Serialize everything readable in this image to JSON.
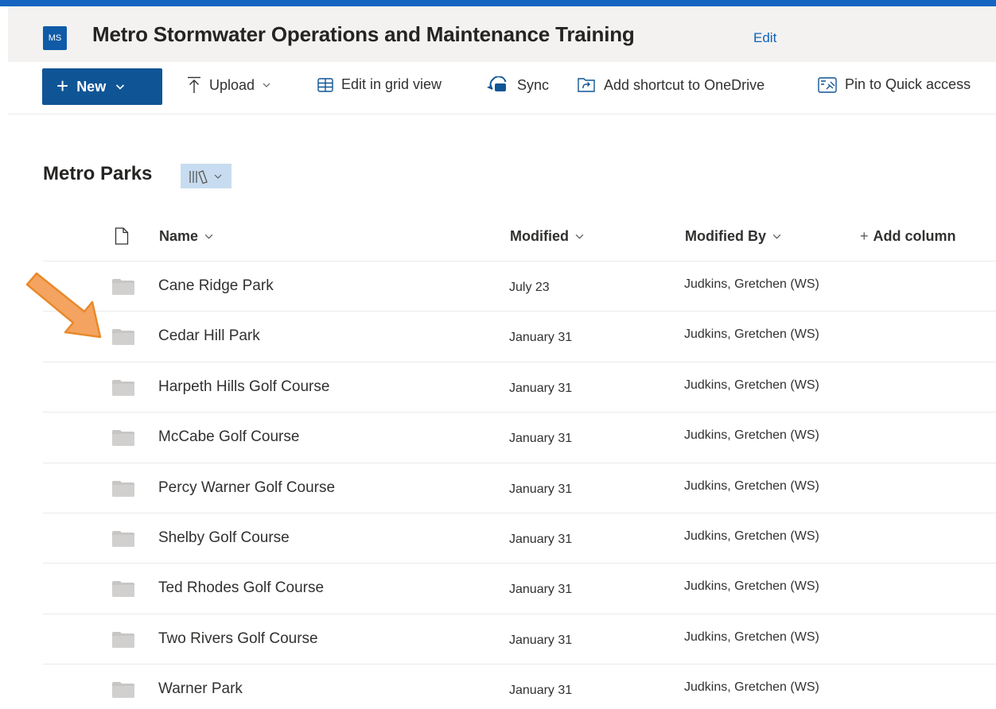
{
  "site": {
    "logo_initials": "MS",
    "title": "Metro Stormwater Operations and Maintenance Training",
    "edit_label": "Edit"
  },
  "colors": {
    "accent_bar": "#1565c0",
    "primary_button": "#0f5596",
    "view_button_bg": "#c7dcf0",
    "arrow_fill": "#f4a460",
    "arrow_stroke": "#e8892a"
  },
  "commands": {
    "new_label": "New",
    "upload_label": "Upload",
    "grid_view_label": "Edit in grid view",
    "sync_label": "Sync",
    "shortcut_label": "Add shortcut to OneDrive",
    "pin_label": "Pin to Quick access"
  },
  "library": {
    "title": "Metro Parks",
    "view_icon": "library-view-icon"
  },
  "columns": {
    "name": "Name",
    "modified": "Modified",
    "modified_by": "Modified By",
    "add_column": "Add column"
  },
  "rows": [
    {
      "name": "Cane Ridge Park",
      "modified": "July 23",
      "modified_by": "Judkins, Gretchen (WS)"
    },
    {
      "name": "Cedar Hill Park",
      "modified": "January 31",
      "modified_by": "Judkins, Gretchen (WS)"
    },
    {
      "name": "Harpeth Hills Golf Course",
      "modified": "January 31",
      "modified_by": "Judkins, Gretchen (WS)"
    },
    {
      "name": "McCabe Golf Course",
      "modified": "January 31",
      "modified_by": "Judkins, Gretchen (WS)"
    },
    {
      "name": "Percy Warner Golf Course",
      "modified": "January 31",
      "modified_by": "Judkins, Gretchen (WS)"
    },
    {
      "name": "Shelby Golf Course",
      "modified": "January 31",
      "modified_by": "Judkins, Gretchen (WS)"
    },
    {
      "name": "Ted Rhodes Golf Course",
      "modified": "January 31",
      "modified_by": "Judkins, Gretchen (WS)"
    },
    {
      "name": "Two Rivers Golf Course",
      "modified": "January 31",
      "modified_by": "Judkins, Gretchen (WS)"
    },
    {
      "name": "Warner Park",
      "modified": "January 31",
      "modified_by": "Judkins, Gretchen (WS)"
    }
  ]
}
